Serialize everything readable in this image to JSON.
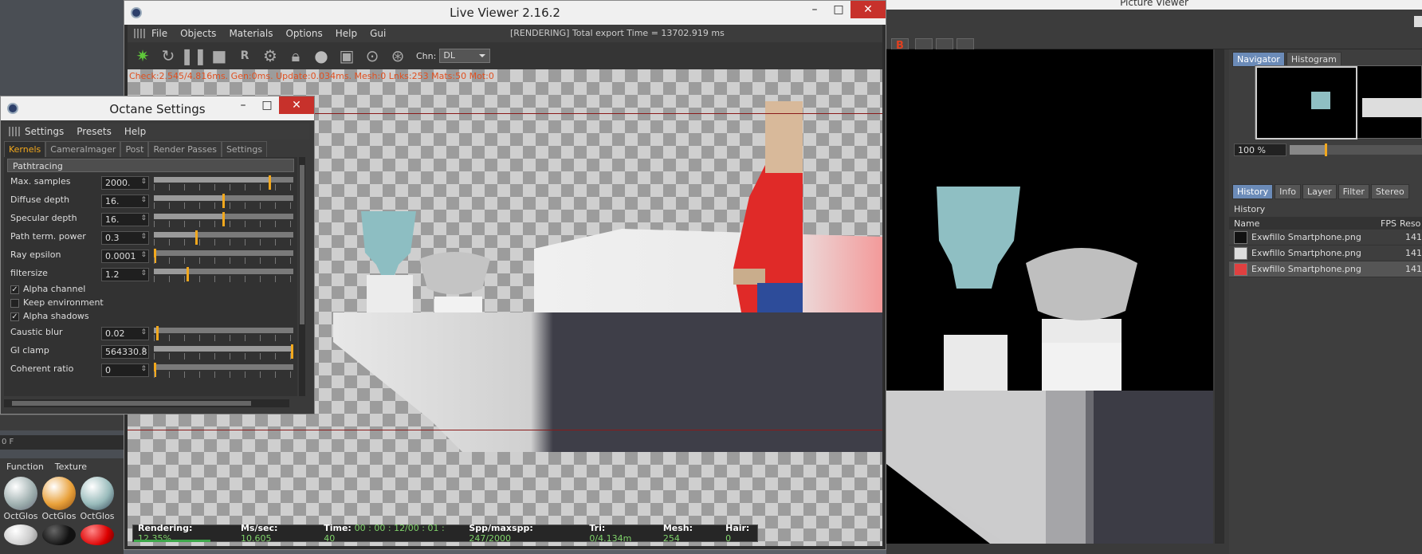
{
  "picture_viewer": {
    "title": "Picture Viewer",
    "tabs_top": [
      "Navigator",
      "Histogram"
    ],
    "zoom": "100 %",
    "tabs_bottom": [
      "History",
      "Info",
      "Layer",
      "Filter",
      "Stereo"
    ],
    "history_label": "History",
    "columns": {
      "name": "Name",
      "fps": "FPS",
      "res": "Reso"
    },
    "rows": [
      {
        "name": "Exwfillo Smartphone.png",
        "res": "141"
      },
      {
        "name": "Exwfillo Smartphone.png",
        "res": "141"
      },
      {
        "name": "Exwfillo Smartphone.png",
        "res": "141"
      }
    ]
  },
  "live_viewer": {
    "title": "Live Viewer 2.16.2",
    "menu": [
      "File",
      "Objects",
      "Materials",
      "Options",
      "Help",
      "Gui"
    ],
    "status": "[RENDERING] Total export Time = 13702.919 ms",
    "channel_label": "Chn:",
    "channel_value": "DL",
    "stats": "Check:2.545/4.816ms. Gen:0ms. Update:0.034ms. Mesh:0 Lnks:253 Mats:50 Mot:0",
    "statusbar": {
      "rendering_label": "Rendering:",
      "rendering": "12.35%",
      "mssec_label": "Ms/sec:",
      "mssec": "10.605",
      "time_label": "Time:",
      "time": "00 : 00 : 12/00 : 01 : 40",
      "spp_label": "Spp/maxspp:",
      "spp": "247/2000",
      "tri_label": "Tri:",
      "tri": "0/4.134m",
      "mesh_label": "Mesh:",
      "mesh": "254",
      "hair_label": "Hair:",
      "hair": "0"
    },
    "progress": 0.1235
  },
  "octane_settings": {
    "title": "Octane Settings",
    "menu": [
      "Settings",
      "Presets",
      "Help"
    ],
    "tabs": [
      "Kernels",
      "CameraImager",
      "Post",
      "Render Passes",
      "Settings"
    ],
    "section": "Pathtracing",
    "params": [
      {
        "label": "Max. samples",
        "value": "2000.",
        "level": 0.84
      },
      {
        "label": "Diffuse depth",
        "value": "16.",
        "level": 0.5
      },
      {
        "label": "Specular depth",
        "value": "16.",
        "level": 0.5
      },
      {
        "label": "Path term. power",
        "value": "0.3",
        "level": 0.3
      },
      {
        "label": "Ray epsilon",
        "value": "0.0001",
        "level": 0.0
      },
      {
        "label": "filtersize",
        "value": "1.2",
        "level": 0.24
      }
    ],
    "checks": [
      {
        "label": "Alpha channel",
        "checked": true
      },
      {
        "label": "Keep environment",
        "checked": false
      },
      {
        "label": "Alpha shadows",
        "checked": true
      }
    ],
    "params2": [
      {
        "label": "Caustic blur",
        "value": "0.02",
        "level": 0.02
      },
      {
        "label": "GI clamp",
        "value": "564330.8",
        "level": 1.0
      },
      {
        "label": "Coherent ratio",
        "value": "0",
        "level": 0.0
      }
    ]
  },
  "background": {
    "timeline": "0 F",
    "material_tabs": [
      "Function",
      "Texture"
    ],
    "materials": [
      "OctGlos",
      "OctGlos",
      "OctGlos"
    ]
  },
  "colors": {
    "accent": "#f2a81d",
    "close": "#c7312b",
    "stats": "#e05020",
    "progress": "#3ea84b"
  }
}
